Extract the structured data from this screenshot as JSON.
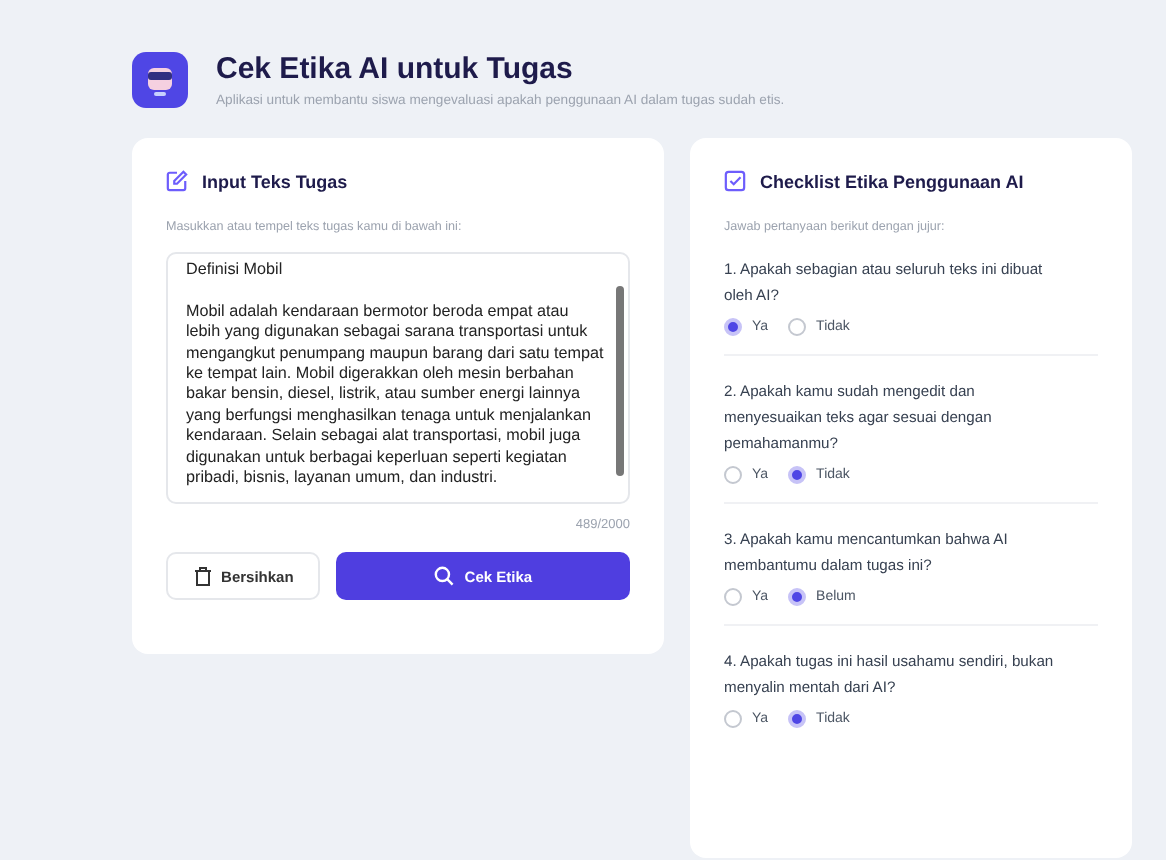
{
  "header": {
    "title": "Cek Etika AI untuk Tugas",
    "subtitle": "Aplikasi untuk membantu siswa mengevaluasi apakah penggunaan AI dalam tugas sudah etis."
  },
  "input_panel": {
    "title": "Input Teks Tugas",
    "instruction": "Masukkan atau tempel teks tugas kamu di bawah ini:",
    "text": "Definisi Mobil\n\nMobil adalah kendaraan bermotor beroda empat atau lebih yang digunakan sebagai sarana transportasi untuk mengangkut penumpang maupun barang dari satu tempat ke tempat lain. Mobil digerakkan oleh mesin berbahan bakar bensin, diesel, listrik, atau sumber energi lainnya yang berfungsi menghasilkan tenaga untuk menjalankan kendaraan. Selain sebagai alat transportasi, mobil juga digunakan untuk berbagai keperluan seperti kegiatan pribadi, bisnis, layanan umum, dan industri.",
    "counter": "489/2000",
    "buttons": [
      {
        "label": "Bersihkan",
        "kind": "secondary"
      },
      {
        "label": "Cek Etika",
        "kind": "primary"
      }
    ]
  },
  "checklist": {
    "title": "Checklist Etika Penggunaan AI",
    "instruction": "Jawab pertanyaan berikut dengan jujur:",
    "questions": [
      {
        "text": "1. Apakah sebagian atau seluruh teks ini dibuat oleh AI?",
        "options": [
          {
            "label": "Ya",
            "selected": true
          },
          {
            "label": "Tidak",
            "selected": false
          }
        ]
      },
      {
        "text": "2. Apakah kamu sudah mengedit dan menyesuaikan teks agar sesuai dengan pemahamanmu?",
        "options": [
          {
            "label": "Ya",
            "selected": false
          },
          {
            "label": "Tidak",
            "selected": true
          }
        ]
      },
      {
        "text": "3. Apakah kamu mencantumkan bahwa AI membantumu dalam tugas ini?",
        "options": [
          {
            "label": "Ya",
            "selected": false
          },
          {
            "label": "Belum",
            "selected": true
          }
        ]
      },
      {
        "text": "4. Apakah tugas ini hasil usahamu sendiri, bukan menyalin mentah dari AI?",
        "options": [
          {
            "label": "Ya",
            "selected": false
          },
          {
            "label": "Tidak",
            "selected": true
          }
        ]
      }
    ]
  }
}
